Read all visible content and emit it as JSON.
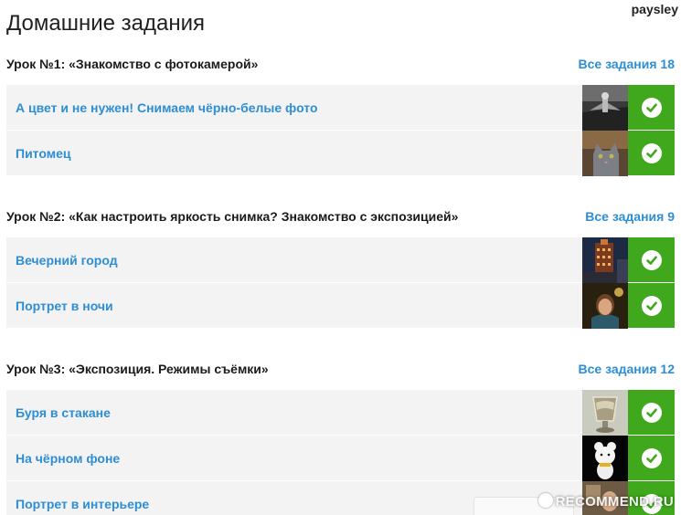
{
  "page": {
    "title": "Домашние задания",
    "username": "paysley"
  },
  "lessons": [
    {
      "title": "Урок №1: «Знакомство с фотокамерой»",
      "all_link": "Все задания 18",
      "tasks": [
        {
          "label": "А цвет и не нужен! Снимаем чёрно-белые фото",
          "thumb": "bw-photo-thumbnail",
          "status": "accepted"
        },
        {
          "label": "Питомец",
          "thumb": "cat-photo-thumbnail",
          "status": "accepted"
        }
      ]
    },
    {
      "title": "Урок №2: «Как настроить яркость снимка? Знакомство с экспозицией»",
      "all_link": "Все задания 9",
      "tasks": [
        {
          "label": "Вечерний город",
          "thumb": "city-photo-thumbnail",
          "status": "accepted"
        },
        {
          "label": "Портрет в ночи",
          "thumb": "portrait-photo-thumbnail",
          "status": "accepted"
        }
      ]
    },
    {
      "title": "Урок №3: «Экспозиция. Режимы съёмки»",
      "all_link": "Все задания 12",
      "tasks": [
        {
          "label": "Буря в стакане",
          "thumb": "glass-photo-thumbnail",
          "status": "accepted"
        },
        {
          "label": "На чёрном фоне",
          "thumb": "toy-photo-thumbnail",
          "status": "accepted"
        },
        {
          "label": "Портрет в интерьере",
          "thumb": "interior-photo-thumbnail",
          "status": "accepted"
        }
      ]
    }
  ],
  "icons": {
    "status": "check-icon"
  },
  "colors": {
    "link": "#2e8ed3",
    "status_ok": "#3fa81c",
    "row_bg": "#f3f3f3"
  },
  "watermark": "RECOMMEND.RU"
}
